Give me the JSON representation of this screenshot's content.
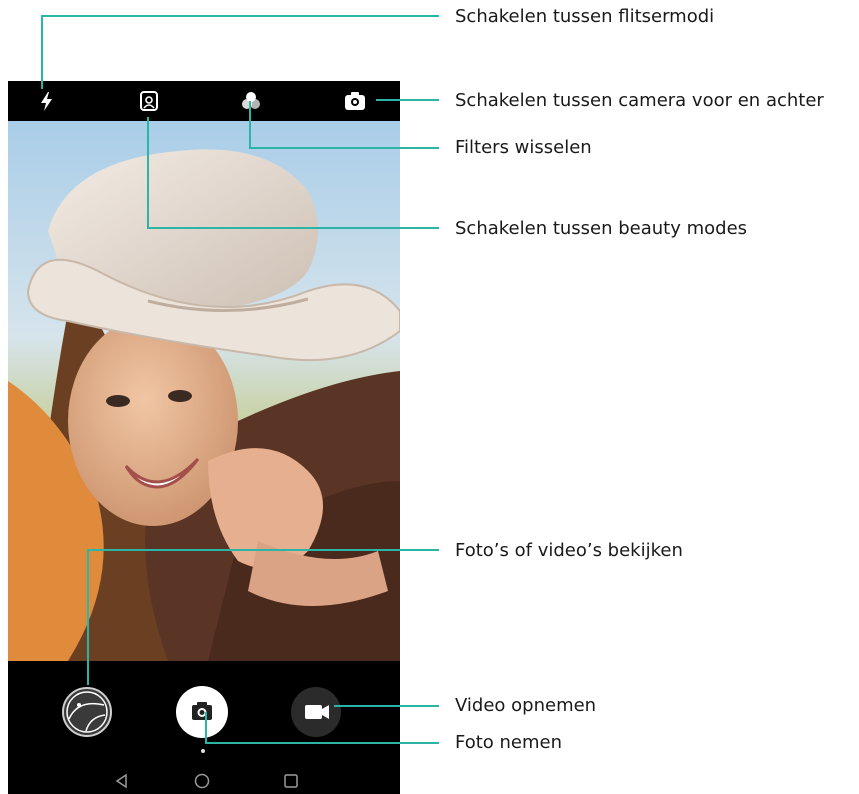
{
  "callouts": {
    "flash": "Schakelen tussen flitsermodi",
    "switch_camera": "Schakelen tussen camera voor en achter",
    "filters": "Filters wisselen",
    "beauty": "Schakelen tussen beauty modes",
    "gallery": "Foto’s of video’s bekijken",
    "record_video": "Video opnemen",
    "take_photo": "Foto nemen"
  },
  "icons": {
    "flash": "flash-icon",
    "beauty": "beauty-mode-icon",
    "filters": "filters-icon",
    "switch_camera": "switch-camera-icon",
    "gallery": "gallery-thumbnail-icon",
    "shutter": "camera-icon",
    "video": "video-camera-icon",
    "back": "back-triangle-icon",
    "home": "home-circle-icon",
    "recents": "recents-square-icon"
  },
  "colors": {
    "callout": "#2bb5a6",
    "bar_background": "#000000"
  }
}
